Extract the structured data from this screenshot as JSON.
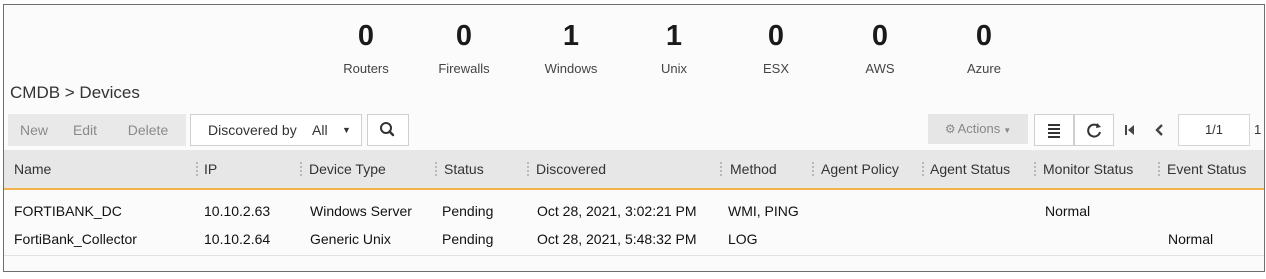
{
  "stats": [
    {
      "count": "0",
      "label": "Routers"
    },
    {
      "count": "0",
      "label": "Firewalls"
    },
    {
      "count": "1",
      "label": "Windows"
    },
    {
      "count": "1",
      "label": "Unix"
    },
    {
      "count": "0",
      "label": "ESX"
    },
    {
      "count": "0",
      "label": "AWS"
    },
    {
      "count": "0",
      "label": "Azure"
    }
  ],
  "breadcrumb": "CMDB > Devices",
  "toolbar": {
    "new_label": "New",
    "edit_label": "Edit",
    "delete_label": "Delete",
    "discovered_label": "Discovered by",
    "discovered_value": "All",
    "actions_label": "Actions",
    "page_current": "1/1",
    "page_total": "1"
  },
  "icons": {
    "search": "search-icon",
    "gear": "gear-icon",
    "list": "list-view-icon",
    "refresh": "refresh-icon",
    "first": "first-page-icon",
    "prev": "previous-page-icon"
  },
  "colors": {
    "header_border": "#f0b24a",
    "header_bg": "#e7e7e7"
  },
  "table": {
    "columns": [
      "Name",
      "IP",
      "Device Type",
      "Status",
      "Discovered",
      "Method",
      "Agent Policy",
      "Agent Status",
      "Monitor Status",
      "Event Status"
    ],
    "rows": [
      [
        "FORTIBANK_DC",
        "10.10.2.63",
        "Windows Server",
        "Pending",
        "Oct 28, 2021, 3:02:21 PM",
        "WMI, PING",
        "",
        "",
        "Normal",
        ""
      ],
      [
        "FortiBank_Collector",
        "10.10.2.64",
        "Generic Unix",
        "Pending",
        "Oct 28, 2021, 5:48:32 PM",
        "LOG",
        "",
        "",
        "",
        "Normal"
      ]
    ]
  }
}
